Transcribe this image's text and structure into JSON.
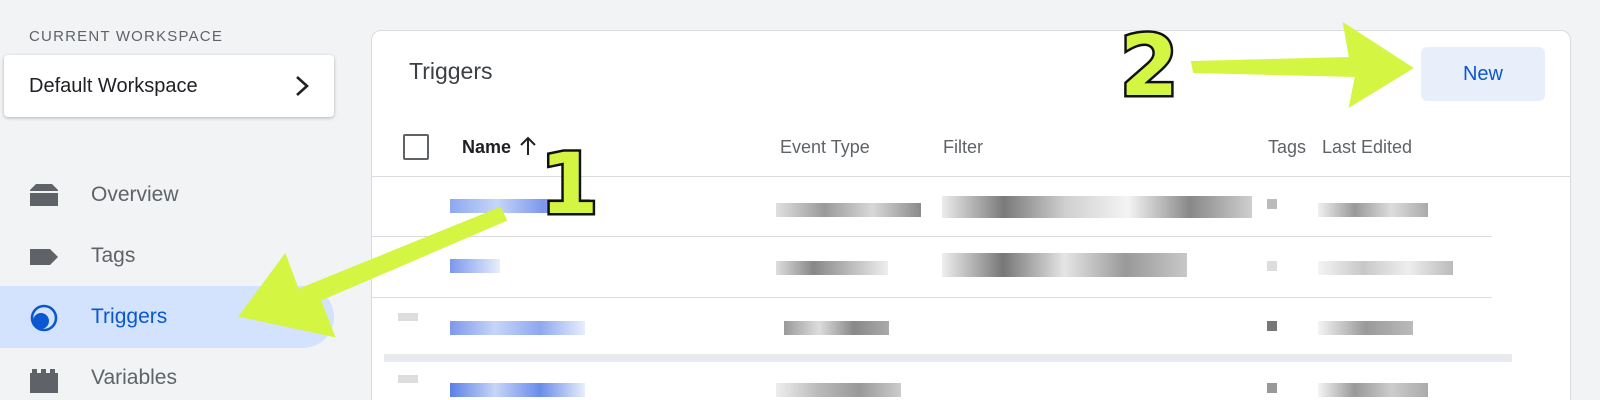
{
  "sidebar": {
    "workspace_label": "CURRENT WORKSPACE",
    "workspace_name": "Default Workspace",
    "items": [
      {
        "label": "Overview",
        "icon": "folder-icon",
        "active": false
      },
      {
        "label": "Tags",
        "icon": "tag-icon",
        "active": false
      },
      {
        "label": "Triggers",
        "icon": "trigger-icon",
        "active": true
      },
      {
        "label": "Variables",
        "icon": "variables-icon",
        "active": false
      }
    ]
  },
  "main": {
    "title": "Triggers",
    "new_button": "New",
    "columns": [
      "Name",
      "Event Type",
      "Filter",
      "Tags",
      "Last Edited"
    ],
    "sort_icon": "arrow-up-icon",
    "search_icon": "search-icon"
  },
  "annotations": {
    "step1": "1",
    "step2": "2",
    "arrow_color": "#d4f542"
  },
  "colors": {
    "accent": "#0b57d0",
    "active_bg": "#d3e3fd",
    "button_bg": "#e8effb"
  }
}
